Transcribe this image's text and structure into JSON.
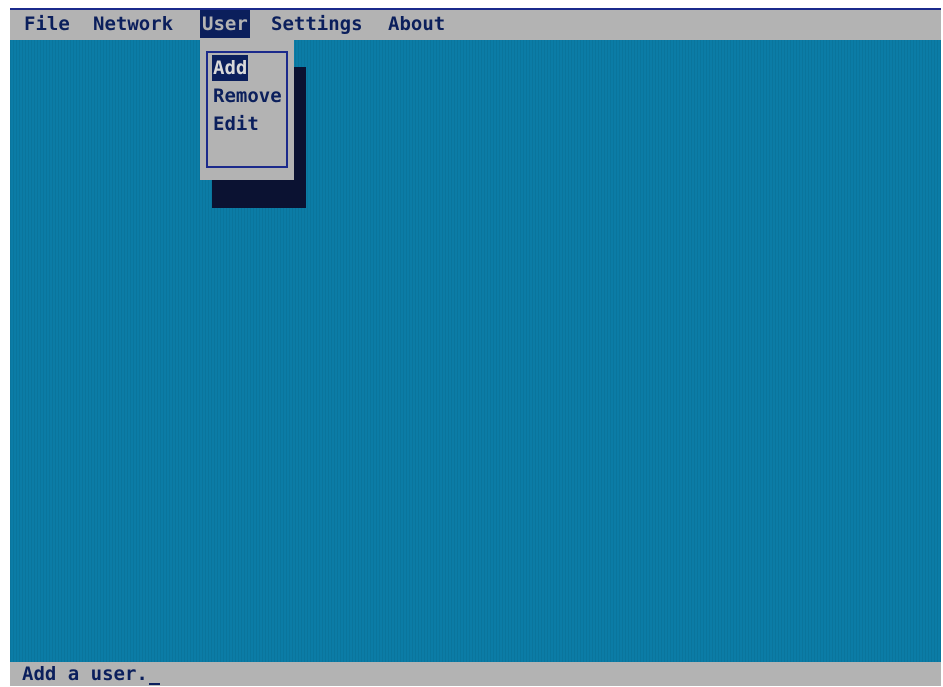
{
  "menubar": {
    "items": [
      {
        "label": "File",
        "active": false
      },
      {
        "label": "Network",
        "active": false
      },
      {
        "label": "User",
        "active": true
      },
      {
        "label": "Settings",
        "active": false
      },
      {
        "label": "About",
        "active": false
      }
    ]
  },
  "dropdown": {
    "parent": "User",
    "options": [
      {
        "label": "Add",
        "selected": true
      },
      {
        "label": "Remove",
        "selected": false
      },
      {
        "label": "Edit",
        "selected": false
      }
    ]
  },
  "statusbar": {
    "text": "Add a user."
  },
  "colors": {
    "desktop": "#0b7ca6",
    "bar": "#b3b3b3",
    "text": "#0b1f5c",
    "highlight": "#0b1f5c",
    "frame": "#1b2a8c"
  }
}
